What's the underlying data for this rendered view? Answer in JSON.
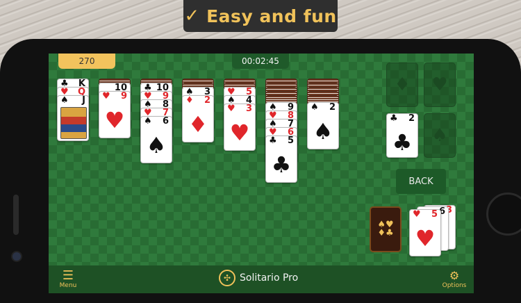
{
  "banner": {
    "check": "✓",
    "title": "Easy and fun"
  },
  "game": {
    "score": "270",
    "timer": "00:02:45",
    "back_label": "BACK"
  },
  "tableau": [
    {
      "top": {
        "rank": "K",
        "suit": "♣",
        "color": "blk"
      },
      "next": {
        "rank": "Q",
        "suit": "♥",
        "color": "red"
      },
      "last": {
        "rank": "J",
        "suit": "♠",
        "color": "blk"
      }
    },
    {
      "card": {
        "rank": "9",
        "suit": "♥",
        "color": "red"
      },
      "peek": "10"
    },
    {
      "pile": [
        "10",
        "9",
        "8",
        "7"
      ],
      "card": {
        "rank": "6",
        "suit": "♠",
        "color": "blk"
      }
    },
    {
      "pile": [
        "3"
      ],
      "card": {
        "rank": "2",
        "suit": "♦",
        "color": "red"
      }
    },
    {
      "pile": [
        "5",
        "4"
      ],
      "card": {
        "rank": "3",
        "suit": "♥",
        "color": "red"
      }
    },
    {
      "pile": [
        "9",
        "8",
        "7",
        "6"
      ],
      "card": {
        "rank": "5",
        "suit": "♣",
        "color": "blk"
      }
    },
    {
      "card": {
        "rank": "2",
        "suit": "♠",
        "color": "blk"
      }
    }
  ],
  "foundations": [
    {
      "symbol": "♦"
    },
    {
      "symbol": "♥"
    },
    {
      "rank": "2",
      "suit": "♣"
    },
    {
      "symbol": "♠"
    }
  ],
  "waste": {
    "back_rank": "3",
    "mid_rank": "6",
    "top_rank": "5",
    "top_suit": "♥"
  },
  "stock": {
    "emblem": "♠♥\n♦♣"
  },
  "bottom": {
    "menu_label": "Menu",
    "app_name": "Solitario Pro",
    "options_label": "Options"
  },
  "icons": {
    "menu": "hamburger-icon",
    "logo": "app-logo-icon",
    "options": "gear-icon"
  }
}
